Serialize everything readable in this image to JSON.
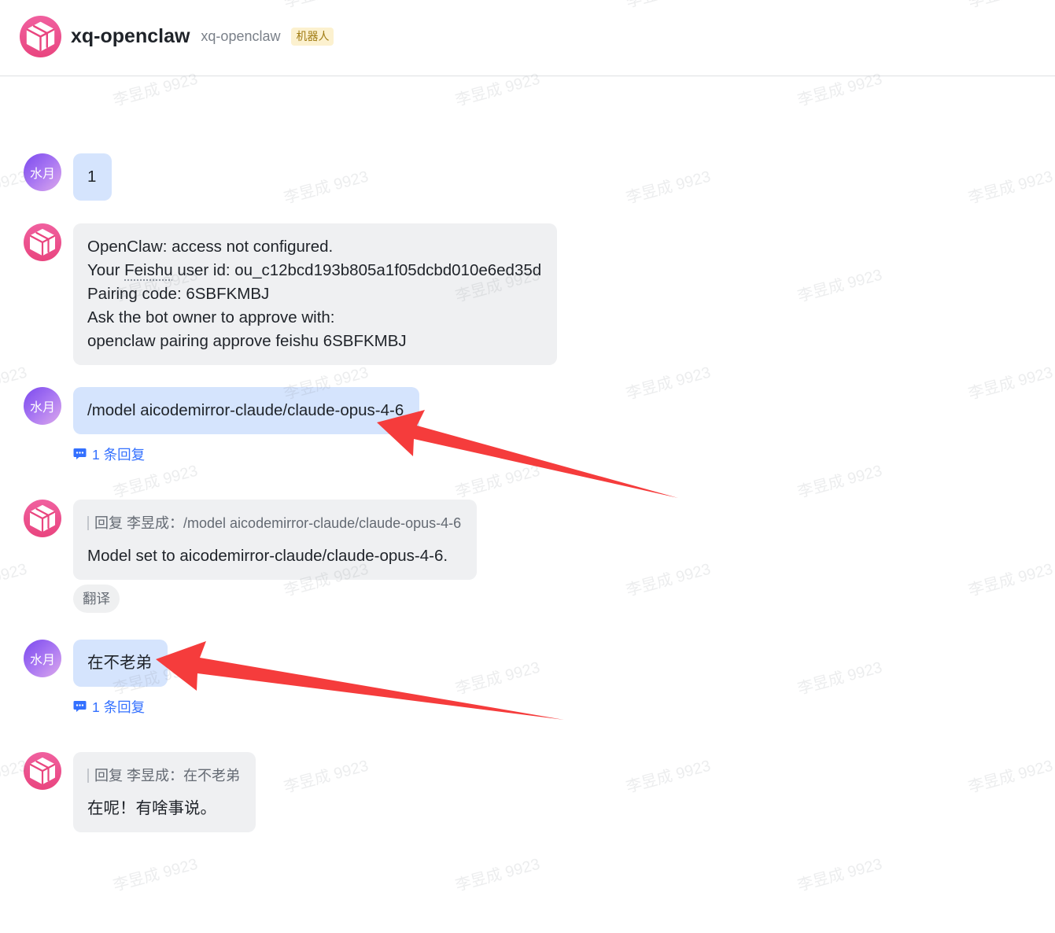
{
  "header": {
    "title": "xq-openclaw",
    "subtitle": "xq-openclaw",
    "badge": "机器人",
    "avatar_icon": "cube-icon"
  },
  "watermark": {
    "text": "李昱成 9923"
  },
  "icons": {
    "thread_replies": "chat-bubble-icon",
    "bot_avatar": "cube-icon"
  },
  "colors": {
    "accent": "#3370ff",
    "text": "#1f2329",
    "secondary_text": "#646a73",
    "self_bubble": "#d5e4fd",
    "other_bubble": "#eff0f2",
    "badge_bg": "#fcf1cf",
    "badge_text": "#a07b12",
    "bot_avatar": "#ec4f8d",
    "user_avatar": "#9360f2",
    "annotation_arrow": "#f53c3c"
  },
  "messages": [
    {
      "avatar_text": "水月",
      "text": "1"
    },
    {
      "avatar_icon": "cube-icon",
      "lines": [
        "OpenClaw: access not configured.",
        [
          "Your ",
          "Feishu",
          " user id: ou_c12bcd193b805a1f05dcbd010e6ed35d"
        ],
        "Pairing code: 6SBFKMBJ",
        "Ask the bot owner to approve with:",
        "openclaw pairing approve feishu 6SBFKMBJ"
      ]
    },
    {
      "avatar_text": "水月",
      "text": "/model aicodemirror-claude/claude-opus-4-6",
      "thread_replies": "1 条回复"
    },
    {
      "avatar_icon": "cube-icon",
      "quote": {
        "prefix": "回复 李昱成：",
        "text": "/model aicodemirror-claude/claude-opus-4-6"
      },
      "text": "Model set to aicodemirror-claude/claude-opus-4-6.",
      "action": "翻译"
    },
    {
      "avatar_text": "水月",
      "text": "在不老弟",
      "thread_replies": "1 条回复"
    },
    {
      "avatar_icon": "cube-icon",
      "quote": {
        "prefix": "回复 李昱成：",
        "text": "在不老弟"
      },
      "text": "在呢！有啥事说。"
    }
  ]
}
